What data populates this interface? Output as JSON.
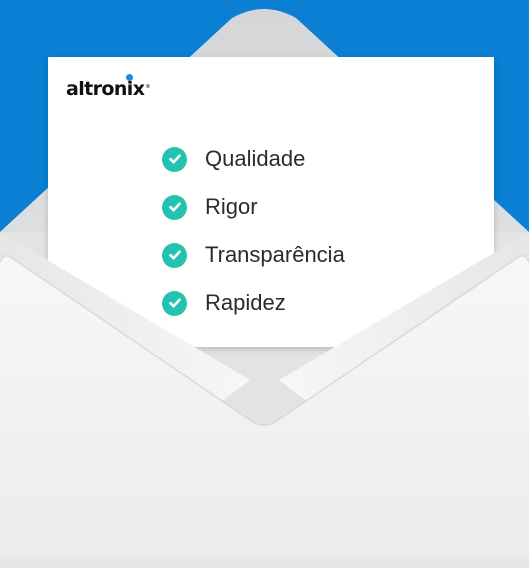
{
  "logo": {
    "part1": "altron",
    "part2": "i",
    "part3": "x",
    "registered": "®"
  },
  "checklist": [
    {
      "label": "Qualidade",
      "icon": "check-circle-icon"
    },
    {
      "label": "Rigor",
      "icon": "check-circle-icon"
    },
    {
      "label": "Transparência",
      "icon": "check-circle-icon"
    },
    {
      "label": "Rapidez",
      "icon": "check-circle-icon"
    }
  ],
  "colors": {
    "background": "#0a7fd3",
    "check": "#25c2b0",
    "logo_dot": "#1c8ae0",
    "envelope": "#f2f2f2"
  }
}
